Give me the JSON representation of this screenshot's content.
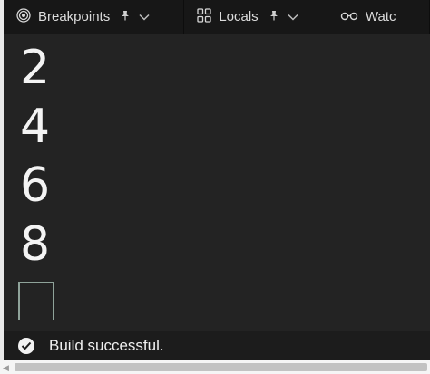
{
  "tabs": [
    {
      "id": "breakpoints",
      "label": "Breakpoints",
      "icon": "breakpoints-icon",
      "pin": "pin-icon",
      "chevron": "chevron-down-icon"
    },
    {
      "id": "locals",
      "label": "Locals",
      "icon": "grid-icon",
      "pin": "pin-icon",
      "chevron": "chevron-down-icon"
    },
    {
      "id": "watch",
      "label": "Watc",
      "icon": "glasses-icon"
    }
  ],
  "output": {
    "lines": [
      "2",
      "4",
      "6",
      "8"
    ]
  },
  "status": {
    "text": "Build successful.",
    "icon": "check-circle-icon"
  }
}
